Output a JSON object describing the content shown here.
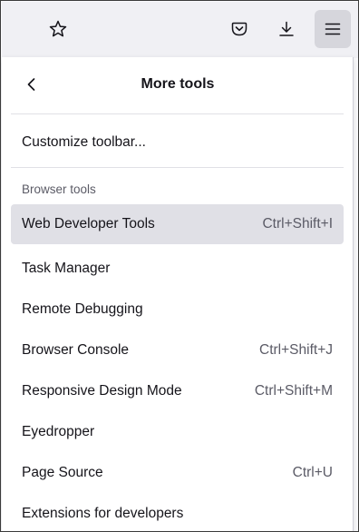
{
  "toolbar": {
    "buttons": [
      {
        "icon": "star-icon"
      },
      {
        "icon": "pocket-icon"
      },
      {
        "icon": "download-icon"
      },
      {
        "icon": "hamburger-menu-icon",
        "active": true
      }
    ]
  },
  "panel": {
    "title": "More tools",
    "back_icon": "chevron-left-icon",
    "customize_label": "Customize toolbar...",
    "section_label": "Browser tools",
    "items": [
      {
        "label": "Web Developer Tools",
        "shortcut": "Ctrl+Shift+I",
        "highlighted": true
      },
      {
        "label": "Task Manager",
        "shortcut": ""
      },
      {
        "label": "Remote Debugging",
        "shortcut": ""
      },
      {
        "label": "Browser Console",
        "shortcut": "Ctrl+Shift+J"
      },
      {
        "label": "Responsive Design Mode",
        "shortcut": "Ctrl+Shift+M"
      },
      {
        "label": "Eyedropper",
        "shortcut": ""
      },
      {
        "label": "Page Source",
        "shortcut": "Ctrl+U"
      },
      {
        "label": "Extensions for developers",
        "shortcut": ""
      }
    ]
  },
  "colors": {
    "toolbar_bg": "#f0f0f4",
    "active_button_bg": "#d6d6dc",
    "hover_item_bg": "#e0e0e6",
    "text": "#15141a",
    "secondary_text": "#5b5b66"
  }
}
